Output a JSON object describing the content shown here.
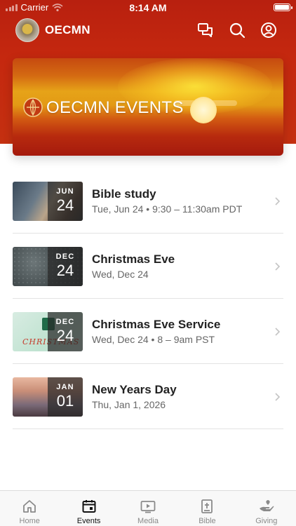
{
  "status_bar": {
    "carrier": "Carrier",
    "time": "8:14 AM"
  },
  "header": {
    "title": "OECMN",
    "icons": [
      "chat-icon",
      "search-icon",
      "account-icon"
    ]
  },
  "banner": {
    "text": "OECMN EVENTS"
  },
  "events": [
    {
      "month": "JUN",
      "day": "24",
      "title": "Bible study",
      "subtitle": "Tue, Jun 24 • 9:30 – 11:30am PDT"
    },
    {
      "month": "DEC",
      "day": "24",
      "title": "Christmas Eve",
      "subtitle": "Wed, Dec 24"
    },
    {
      "month": "DEC",
      "day": "24",
      "title": "Christmas Eve Service",
      "subtitle": "Wed, Dec 24 • 8 – 9am PST",
      "thumb_text": "CHRISTMAS"
    },
    {
      "month": "JAN",
      "day": "01",
      "title": "New Years Day",
      "subtitle": "Thu, Jan 1, 2026"
    }
  ],
  "tabs": [
    {
      "label": "Home",
      "icon": "home-icon",
      "active": false
    },
    {
      "label": "Events",
      "icon": "calendar-icon",
      "active": true
    },
    {
      "label": "Media",
      "icon": "media-icon",
      "active": false
    },
    {
      "label": "Bible",
      "icon": "bible-icon",
      "active": false
    },
    {
      "label": "Giving",
      "icon": "giving-icon",
      "active": false
    }
  ],
  "colors": {
    "header_red": "#c5280f",
    "active_tab": "#111111",
    "inactive_tab": "#8a8a8a"
  }
}
